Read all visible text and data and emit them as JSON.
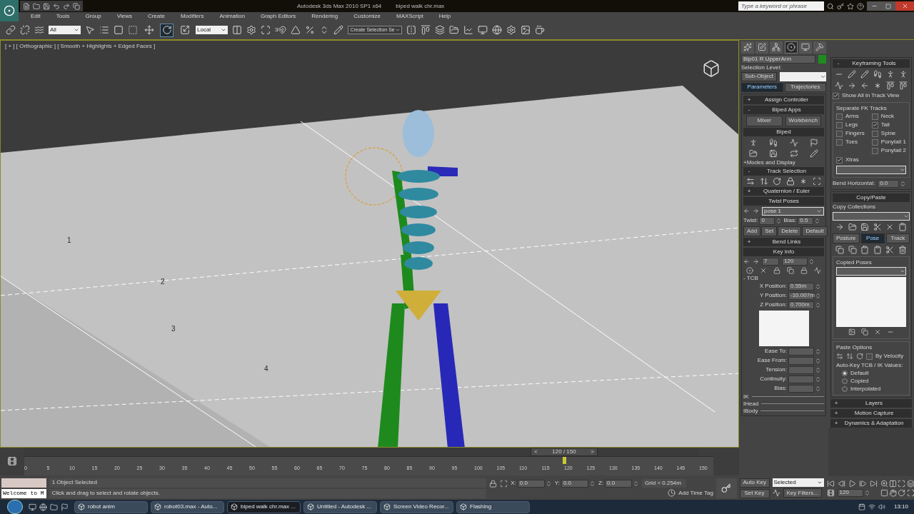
{
  "title_bar": {
    "app_title": "Autodesk 3ds Max 2010 SP1 x64",
    "file": "biped walk chr.max",
    "search_placeholder": "Type a keyword or phrase"
  },
  "menu": [
    "Edit",
    "Tools",
    "Group",
    "Views",
    "Create",
    "Modifiers",
    "Animation",
    "Graph Editors",
    "Rendering",
    "Customize",
    "MAXScript",
    "Help"
  ],
  "toolbar": {
    "selection_filter": "All",
    "coord_system": "Local",
    "snap_label": "3",
    "named_selection": "Create Selection Se",
    "transform_tools": [
      {
        "selected": false
      },
      {
        "selected": true
      },
      {
        "selected": false
      }
    ]
  },
  "viewport": {
    "label": "[ + ] [ Orthographic ] [ Smooth + Highlights + Edged Faces ]",
    "grid_labels": [
      "1",
      "2",
      "3",
      "4"
    ]
  },
  "command_panel": {
    "tabs": [
      {
        "selected": false
      },
      {
        "selected": false
      },
      {
        "selected": false
      },
      {
        "selected": true
      },
      {
        "selected": false
      },
      {
        "selected": false
      }
    ],
    "object_name": "Bip01 R UpperArm",
    "selection_level": "Selection Level:",
    "sub_object": "Sub-Object",
    "sub_tabs": [
      {
        "label": "Parameters",
        "selected": true
      },
      {
        "label": "Trajectories",
        "selected": false
      }
    ],
    "assign_controller": {
      "sign": "+",
      "title": "Assign Controller"
    },
    "biped_apps": {
      "sign": "-",
      "title": "Biped Apps",
      "buttons": [
        "Mixer",
        "Workbench"
      ]
    },
    "biped": {
      "title": "Biped",
      "modes": "+Modes and Display"
    },
    "track_selection": {
      "sign": "-",
      "title": "Track Selection"
    },
    "quaternion": {
      "sign": "+",
      "title": "Quaternion / Euler"
    },
    "twist_poses": {
      "title": "Twist Poses",
      "pose": "pose 1",
      "twist_label": "Twist:",
      "twist": "0",
      "bias_label": "Bias:",
      "bias": "0.5",
      "buttons": [
        "Add",
        "Set",
        "Delete",
        "Default"
      ]
    },
    "bend_links": {
      "sign": "+",
      "title": "Bend Links"
    },
    "key_info": {
      "title": "Key Info",
      "key": "7",
      "frame": "120",
      "tcb": "- TCB",
      "positions": [
        {
          "label": "X Position:",
          "value": "0.55m"
        },
        {
          "label": "Y Position:",
          "value": "-10.007m"
        },
        {
          "label": "Z Position:",
          "value": "0.700m"
        }
      ],
      "params": [
        "Ease To:",
        "Ease From:",
        "Tension:",
        "Continuity:",
        "Bias:"
      ],
      "tracks": [
        "IK",
        "IHead",
        "IBody"
      ]
    }
  },
  "biped_panel": {
    "keyframing": {
      "sign": "-",
      "title": "Keyframing Tools"
    },
    "show_all": {
      "label": "Show All in Track View",
      "checked": true
    },
    "fk_group": "Separate FK Tracks",
    "fk_left": [
      {
        "label": "Arms",
        "checked": false
      },
      {
        "label": "Legs",
        "checked": false
      },
      {
        "label": "Fingers",
        "checked": false
      },
      {
        "label": "Toes",
        "checked": false
      }
    ],
    "fk_right": [
      {
        "label": "Neck",
        "checked": false
      },
      {
        "label": "Tail",
        "checked": true
      },
      {
        "label": "Spine",
        "checked": false
      },
      {
        "label": "Ponytail 1",
        "checked": false
      },
      {
        "label": "Ponytail 2",
        "checked": false
      }
    ],
    "xtras": {
      "label": "Xtras",
      "checked": true
    },
    "bend_label": "Bend Horizontal:",
    "bend_value": "0.0",
    "copy_paste": "Copy/Paste",
    "collections": "Copy Collections",
    "modes": [
      {
        "label": "Posture",
        "selected": false
      },
      {
        "label": "Pose",
        "selected": true
      },
      {
        "label": "Track",
        "selected": false
      }
    ],
    "copied_poses": "Copied Poses",
    "paste_options": "Paste Options",
    "by_velocity": {
      "label": "By Velocity",
      "checked": false
    },
    "auto_key": "Auto-Key TCB / IK Values:",
    "radios": [
      {
        "label": "Default",
        "selected": true
      },
      {
        "label": "Copied",
        "selected": false
      },
      {
        "label": "Interpolated",
        "selected": false
      }
    ],
    "rollouts": [
      {
        "sign": "+",
        "title": "Layers"
      },
      {
        "sign": "+",
        "title": "Motion Capture"
      },
      {
        "sign": "+",
        "title": "Dynamics & Adaptation"
      }
    ]
  },
  "timeline": {
    "slider": "120 / 150",
    "prev": "<",
    "next": ">",
    "level": 0.8,
    "frames": [
      "0",
      "5",
      "10",
      "15",
      "20",
      "25",
      "30",
      "35",
      "40",
      "45",
      "50",
      "55",
      "60",
      "65",
      "70",
      "75",
      "80",
      "85",
      "90",
      "95",
      "100",
      "105",
      "110",
      "115",
      "120",
      "125",
      "130",
      "135",
      "140",
      "145",
      "150"
    ]
  },
  "status": {
    "listener": "Welcome to M",
    "selected": "1 Object Selected",
    "prompt": "Click and drag to select and rotate objects.",
    "coords": [
      {
        "label": "X:",
        "value": "0.0"
      },
      {
        "label": "Y:",
        "value": "0.0"
      },
      {
        "label": "Z:",
        "value": "0.0"
      }
    ],
    "grid": "Grid = 0.254m",
    "time_tag": "Add Time Tag",
    "auto_key": "Auto Key",
    "set_key": "Set Key",
    "key_mode": "Selected",
    "key_filters": "Key Filters...",
    "frame": "120"
  },
  "taskbar": {
    "tasks": [
      {
        "label": "robot anim",
        "selected": false
      },
      {
        "label": "robot03.max - Auto...",
        "selected": false
      },
      {
        "label": "biped walk chr.max ...",
        "selected": true
      },
      {
        "label": "Untitled - Autodesk ...",
        "selected": false
      },
      {
        "label": "Screen Video Recor...",
        "selected": false
      },
      {
        "label": "Flashing",
        "selected": false
      }
    ],
    "clock": "13:10"
  }
}
